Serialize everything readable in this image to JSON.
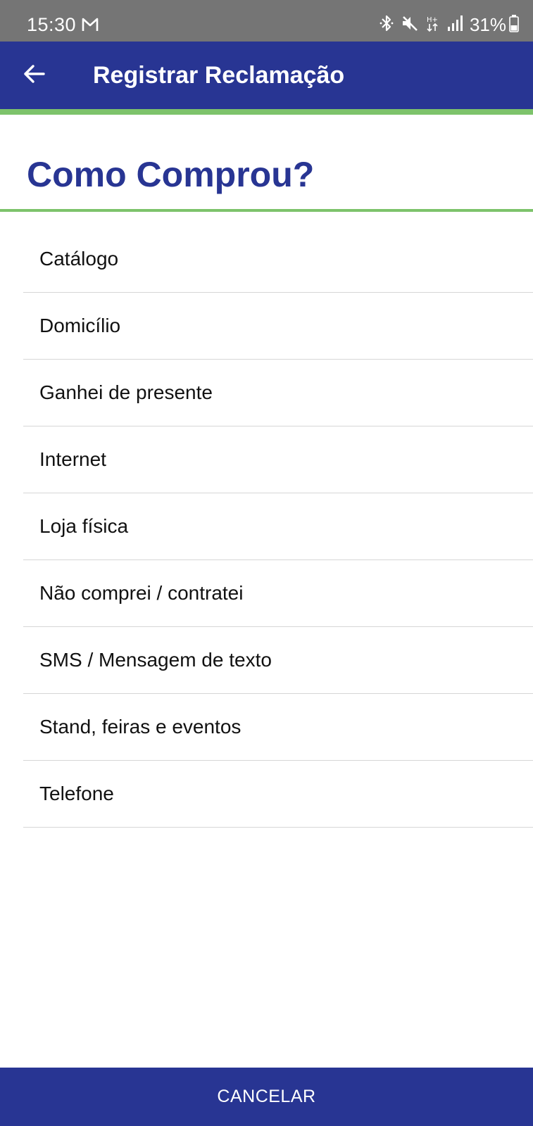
{
  "status_bar": {
    "time": "15:30",
    "battery_percent": "31%",
    "icons": [
      "gmail-icon",
      "bluetooth-icon",
      "mute-icon",
      "hplus-data-icon",
      "signal-icon",
      "battery-icon"
    ]
  },
  "app_bar": {
    "title": "Registrar Reclamação",
    "back_icon": "arrow-left-icon"
  },
  "section": {
    "title": "Como Comprou?"
  },
  "options": [
    {
      "label": "Catálogo"
    },
    {
      "label": "Domicílio"
    },
    {
      "label": "Ganhei de presente"
    },
    {
      "label": "Internet"
    },
    {
      "label": "Loja física"
    },
    {
      "label": "Não comprei / contratei"
    },
    {
      "label": "SMS / Mensagem de texto"
    },
    {
      "label": "Stand, feiras e eventos"
    },
    {
      "label": "Telefone"
    }
  ],
  "footer": {
    "cancel_label": "CANCELAR"
  },
  "colors": {
    "primary": "#283593",
    "accent": "#7dc36b",
    "status_bar": "#757575"
  }
}
